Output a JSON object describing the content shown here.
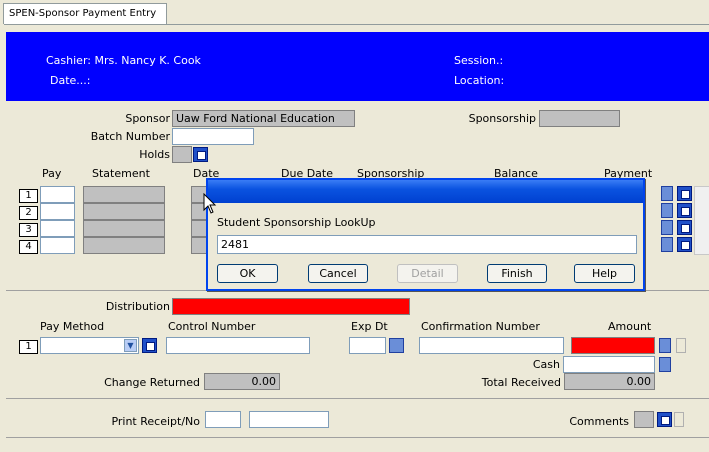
{
  "tab": {
    "label": "SPEN-Sponsor Payment Entry"
  },
  "header": {
    "cashier": "Cashier:  Mrs. Nancy K. Cook",
    "date": "Date...:",
    "session": "Session.:",
    "location": "Location:"
  },
  "sponsor": {
    "sponsor_label": "Sponsor",
    "sponsor_value": "Uaw Ford National Education",
    "sponsorship_label": "Sponsorship",
    "batch_label": "Batch Number",
    "holds_label": "Holds"
  },
  "grid": {
    "columns": [
      "Pay",
      "Statement",
      "Date",
      "Due Date",
      "Sponsorship",
      "Balance",
      "Payment"
    ],
    "rows": [
      "1",
      "2",
      "3",
      "4"
    ]
  },
  "dialog": {
    "title": "",
    "prompt": "Student Sponsorship LookUp",
    "input_value": "2481",
    "buttons": {
      "ok": "OK",
      "cancel": "Cancel",
      "detail": "Detail",
      "finish": "Finish",
      "help": "Help"
    }
  },
  "payment": {
    "distribution_label": "Distribution",
    "pay_method_label": "Pay Method",
    "control_number_label": "Control Number",
    "exp_dt_label": "Exp Dt",
    "confirmation_label": "Confirmation Number",
    "amount_label": "Amount",
    "row_number": "1",
    "cash_label": "Cash",
    "change_returned_label": "Change Returned",
    "change_returned_value": "0.00",
    "total_received_label": "Total Received",
    "total_received_value": "0.00"
  },
  "footer": {
    "print_receipt_label": "Print Receipt/No",
    "comments_label": "Comments"
  },
  "colors": {
    "banner": "#0000ff",
    "required": "#ff0000",
    "dialog_title": "#0a53e0"
  }
}
